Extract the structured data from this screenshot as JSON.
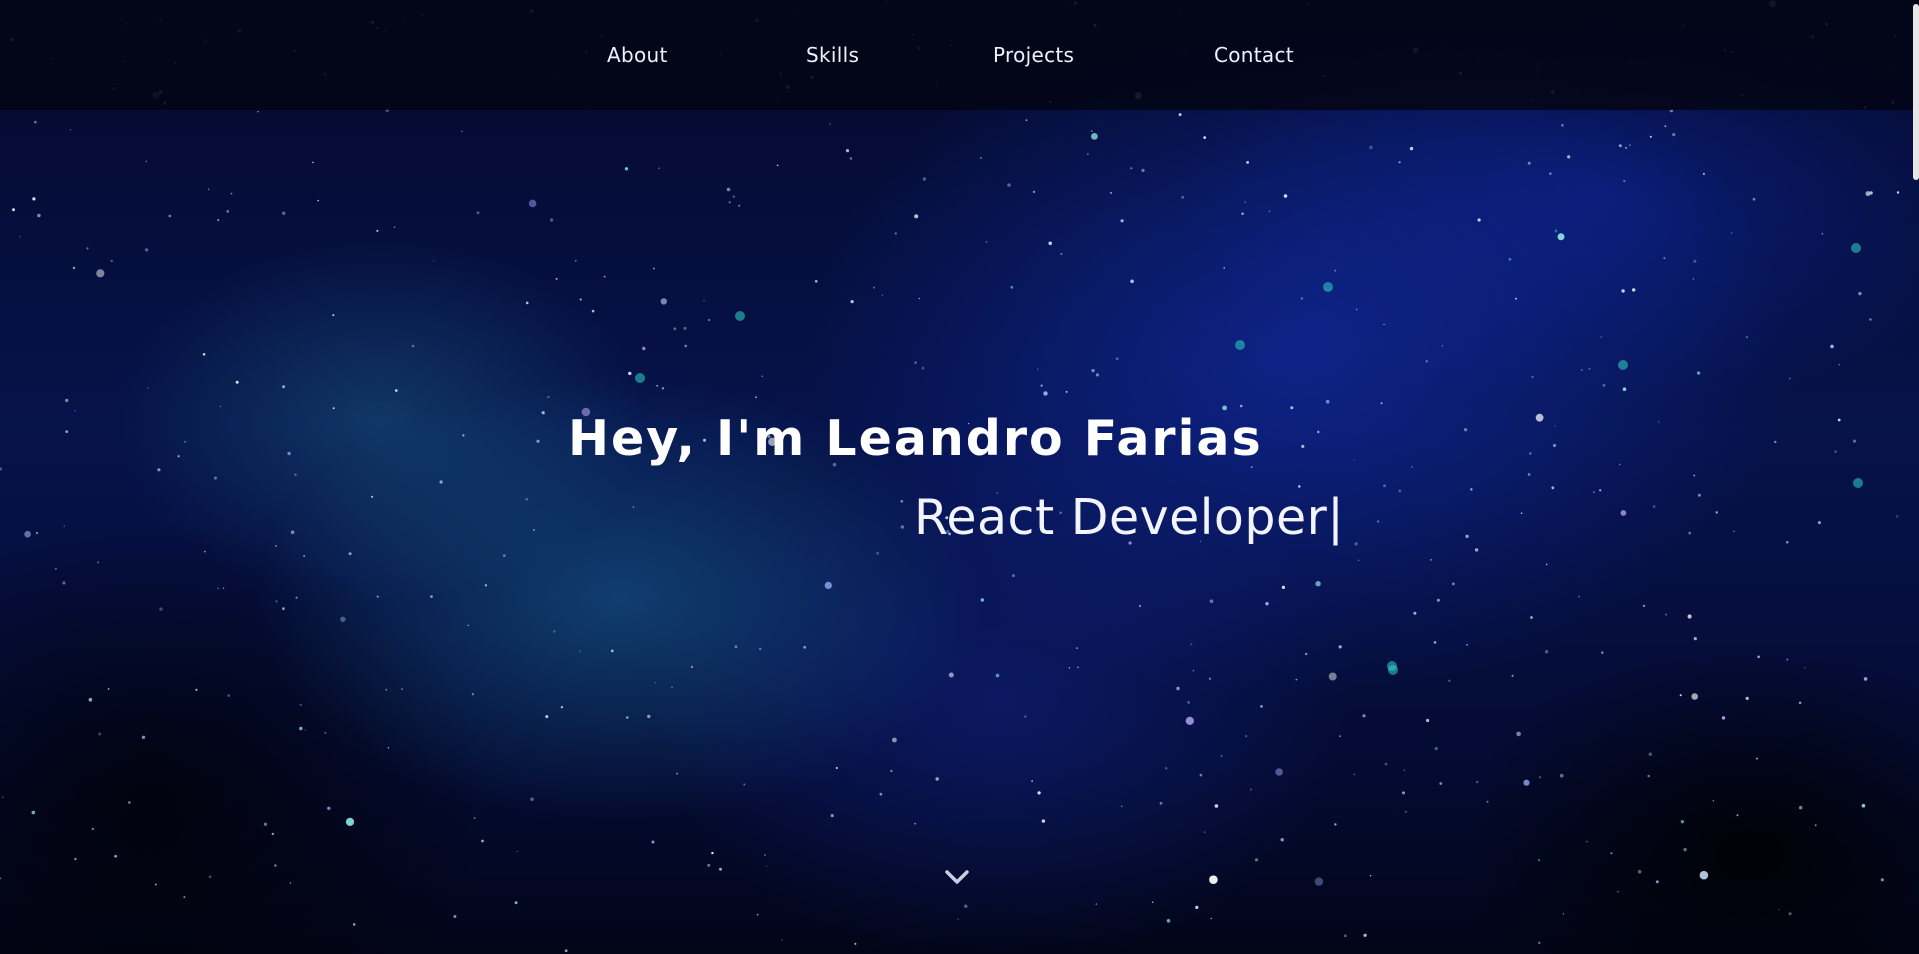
{
  "nav": {
    "items": [
      {
        "label": "About"
      },
      {
        "label": "Skills"
      },
      {
        "label": "Projects"
      },
      {
        "label": "Contact"
      }
    ]
  },
  "hero": {
    "title": "Hey, I'm Leandro Farias",
    "subtitle": "React Developer|"
  },
  "icons": {
    "scroll_down": "chevron-down-icon"
  },
  "colors": {
    "background": "#040b33",
    "navbar": "#03061a",
    "text": "#ffffff"
  }
}
